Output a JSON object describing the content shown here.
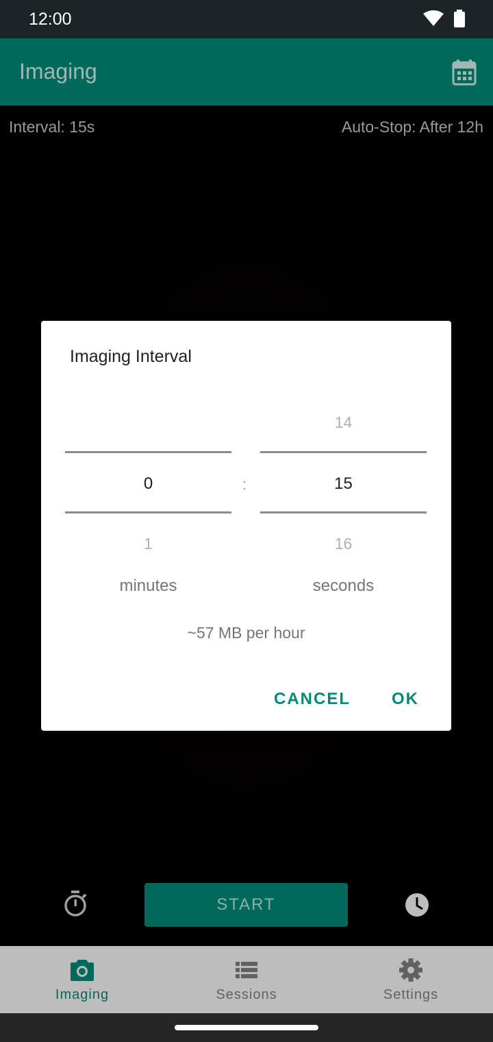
{
  "status_bar": {
    "time": "12:00"
  },
  "app_bar": {
    "title": "Imaging"
  },
  "camera": {
    "interval_label": "Interval: 15s",
    "auto_stop_label": "Auto-Stop: After 12h",
    "start_label": "START"
  },
  "dialog": {
    "title": "Imaging Interval",
    "minutes": {
      "prev": "",
      "current": "0",
      "next": "1",
      "unit": "minutes"
    },
    "separator": ":",
    "seconds": {
      "prev": "14",
      "current": "15",
      "next": "16",
      "unit": "seconds"
    },
    "estimate": "~57 MB per hour",
    "cancel_label": "CANCEL",
    "ok_label": "OK"
  },
  "bottom_nav": {
    "items": [
      {
        "label": "Imaging",
        "icon": "camera-icon",
        "active": true
      },
      {
        "label": "Sessions",
        "icon": "list-icon",
        "active": false
      },
      {
        "label": "Settings",
        "icon": "gear-icon",
        "active": false
      }
    ]
  },
  "colors": {
    "primary": "#00695c",
    "accent": "#00897b",
    "status_bar": "#1c2426",
    "nav_background": "#bdbdbd"
  }
}
